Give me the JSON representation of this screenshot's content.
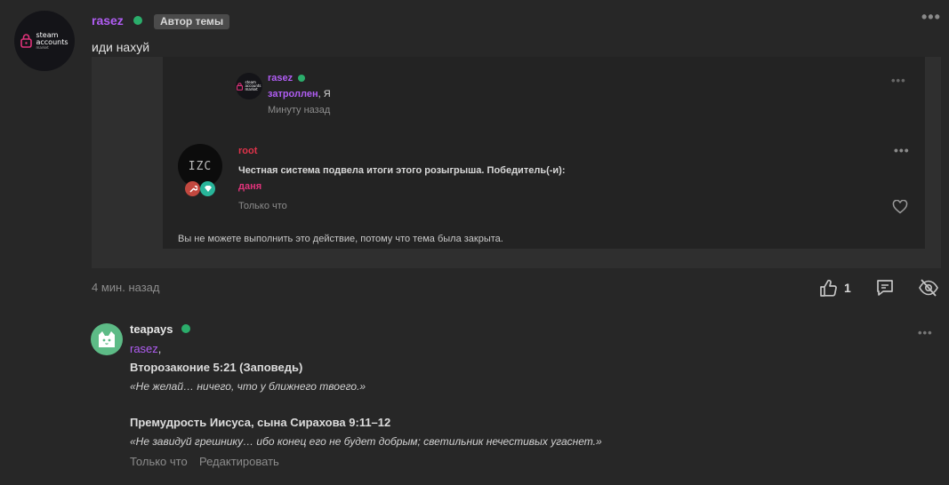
{
  "post": {
    "author": "rasez",
    "author_badge": "Автор темы",
    "avatar_text": [
      "steam",
      "accounts",
      "market"
    ],
    "message": "иди нахуй",
    "time": "4 мин. назад",
    "likes": "1"
  },
  "reply_rasez": {
    "author": "rasez",
    "avatar_text": [
      "steam",
      "accounts",
      "market"
    ],
    "mention": "затроллен",
    "text_after": ", Я",
    "time": "Минуту назад"
  },
  "reply_root": {
    "author": "root",
    "avatar_text": "IZC",
    "text": "Честная система подвела итоги этого розыгрыша. Победитель(-и):",
    "winner": "даня",
    "time": "Только что"
  },
  "closed_notice": "Вы не можете выполнить это действие, потому что тема была закрыта.",
  "post2": {
    "author": "teapays",
    "mention": "rasez",
    "mention_suffix": ",",
    "line1_title": "Второзаконие 5:21 (Заповедь)",
    "line1_quote": "«Не желай… ничего, что у ближнего твоего.»",
    "line2_title": "Премудрость Иисуса, сына Сирахова 9:11–12",
    "line2_quote": "«Не завидуй грешнику… ибо конец его не будет добрым; светильник нечестивых угаснет.»",
    "time": "Только что",
    "edit_label": "Редактировать"
  },
  "colors": {
    "background": "#272727",
    "username": "#b05df3",
    "root_name": "#e0334a",
    "winner": "#e0337a",
    "online": "#2bad6b"
  }
}
